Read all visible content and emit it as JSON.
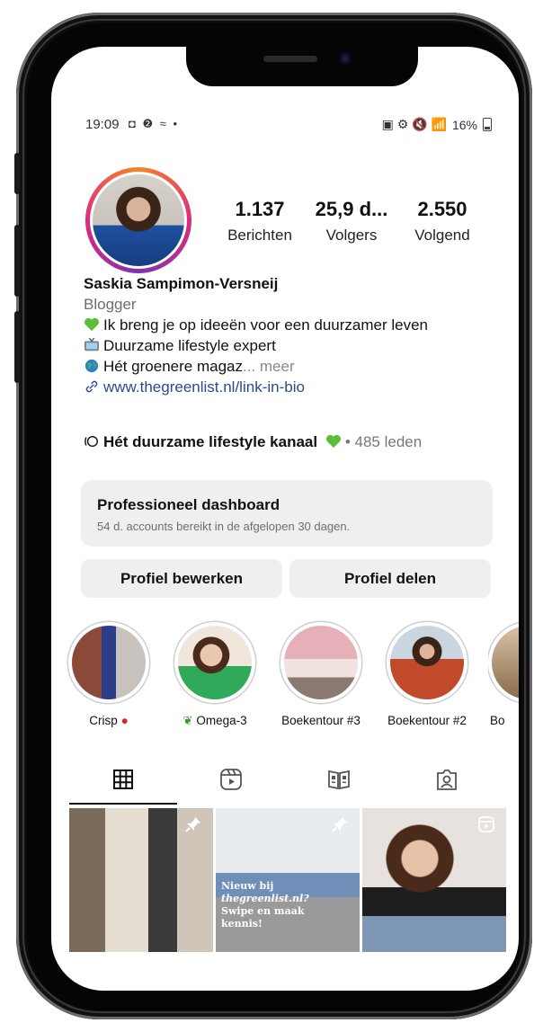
{
  "status_bar": {
    "time": "19:09",
    "left_icons": "◘ ❷ ≈ •",
    "right_icons": "▣ ⚙ 🔇 📶",
    "battery": "16%"
  },
  "profile": {
    "stats": [
      {
        "value": "1.137",
        "label": "Berichten"
      },
      {
        "value": "25,9 d...",
        "label": "Volgers"
      },
      {
        "value": "2.550",
        "label": "Volgend"
      }
    ],
    "name": "Saskia Sampimon-Versneij",
    "category": "Blogger",
    "bio_lines": [
      "Ik breng je op ideeën voor een duurzamer leven",
      "Duurzame lifestyle expert",
      "Hét groenere magaz"
    ],
    "more": "... meer",
    "link": "www.thegreenlist.nl/link-in-bio"
  },
  "channel": {
    "name": "Hét duurzame lifestyle kanaal",
    "members": "• 485 leden"
  },
  "dashboard": {
    "title": "Professioneel dashboard",
    "subtitle": "54 d. accounts bereikt in de afgelopen 30 dagen."
  },
  "buttons": {
    "edit_profile": "Profiel bewerken",
    "share_profile": "Profiel delen"
  },
  "highlights": [
    {
      "label": "Crisp",
      "emoji": "strawberry"
    },
    {
      "label": "Omega-3",
      "emoji": "seedling"
    },
    {
      "label": "Boekentour #3"
    },
    {
      "label": "Boekentour #2"
    },
    {
      "label": "Bo"
    }
  ],
  "tabs": [
    {
      "name": "grid-icon"
    },
    {
      "name": "reels-icon"
    },
    {
      "name": "guides-icon"
    },
    {
      "name": "tagged-icon"
    }
  ],
  "posts": [
    {
      "caption": []
    },
    {
      "caption": [
        "Nieuw bij",
        "thegreenlist.nl?",
        "Swipe en maak",
        "kennis!"
      ]
    },
    {
      "caption": []
    }
  ],
  "colors": {
    "accent_link": "#2c4a8f",
    "button_bg": "#efefef",
    "story_ring": "#dd2a7b"
  }
}
